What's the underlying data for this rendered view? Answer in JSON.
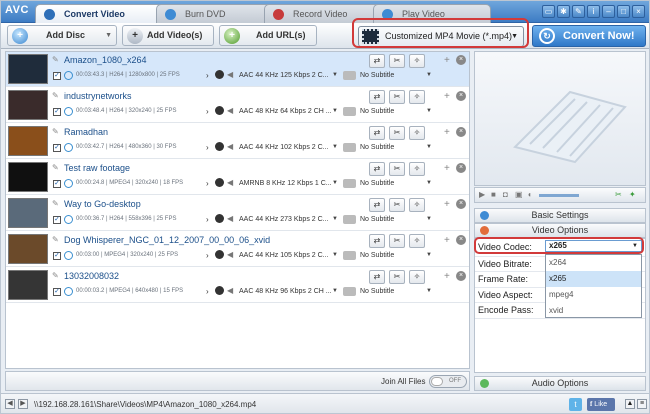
{
  "app": {
    "logo": "AVC"
  },
  "tabs": [
    {
      "label": "Convert Video",
      "active": true,
      "icon": "film-icon"
    },
    {
      "label": "Burn DVD",
      "active": false,
      "icon": "disc-icon"
    },
    {
      "label": "Record Video",
      "active": false,
      "icon": "record-icon"
    },
    {
      "label": "Play Video",
      "active": false,
      "icon": "play-icon"
    }
  ],
  "window_buttons": [
    "monitor-icon",
    "gear-icon",
    "wrench-icon",
    "info-icon",
    "minimize-icon",
    "maximize-icon",
    "close-icon"
  ],
  "toolbar": {
    "add_disc": "Add Disc",
    "add_videos": "Add Video(s)",
    "add_urls": "Add URL(s)",
    "profile": "Customized MP4 Movie (*.mp4)",
    "convert_now": "Convert Now!"
  },
  "files": [
    {
      "name": "Amazon_1080_x264",
      "duration": "00:03:43.3",
      "codec": "H264",
      "resolution": "1280x800",
      "fps": "25 FPS",
      "audio": "AAC 44 KHz 125 Kbps 2 C...",
      "subtitle": "No Subtitle",
      "selected": true
    },
    {
      "name": "industrynetworks",
      "duration": "00:03:48.4",
      "codec": "H264",
      "resolution": "320x240",
      "fps": "25 FPS",
      "audio": "AAC 48 KHz 64 Kbps 2 CH ...",
      "subtitle": "No Subtitle",
      "selected": false
    },
    {
      "name": "Ramadhan",
      "duration": "00:03:42.7",
      "codec": "H264",
      "resolution": "480x360",
      "fps": "30 FPS",
      "audio": "AAC 44 KHz 102 Kbps 2 C...",
      "subtitle": "No Subtitle",
      "selected": false
    },
    {
      "name": "Test raw footage",
      "duration": "00:00:24.8",
      "codec": "MPEG4",
      "resolution": "320x240",
      "fps": "18 FPS",
      "audio": "AMRNB 8 KHz 12 Kbps 1 C...",
      "subtitle": "No Subtitle",
      "selected": false
    },
    {
      "name": "Way to Go-desktop",
      "duration": "00:00:36.7",
      "codec": "H264",
      "resolution": "558x396",
      "fps": "25 FPS",
      "audio": "AAC 44 KHz 273 Kbps 2 C...",
      "subtitle": "No Subtitle",
      "selected": false
    },
    {
      "name": "Dog Whisperer_NGC_01_12_2007_00_00_06_xvid",
      "duration": "00:03:00",
      "codec": "MPEG4",
      "resolution": "320x240",
      "fps": "25 FPS",
      "audio": "AAC 44 KHz 105 Kbps 2 C...",
      "subtitle": "No Subtitle",
      "selected": false
    },
    {
      "name": "13032008032",
      "duration": "00:00:03.2",
      "codec": "MPEG4",
      "resolution": "640x480",
      "fps": "15 FPS",
      "audio": "AAC 48 KHz 96 Kbps 2 CH ...",
      "subtitle": "No Subtitle",
      "selected": false
    }
  ],
  "settings": {
    "basic_settings": "Basic Settings",
    "video_options": "Video Options",
    "audio_options": "Audio Options",
    "labels": [
      "Video Codec:",
      "Video Bitrate:",
      "Frame Rate:",
      "Video Aspect:",
      "Encode Pass:"
    ],
    "codec_value": "x265",
    "codec_options": [
      "x264",
      "x265",
      "mpeg4",
      "xvid"
    ],
    "codec_selected_option": "x265"
  },
  "join": {
    "label": "Join All Files",
    "toggle": "OFF"
  },
  "status": {
    "path": "\\\\192.168.28.161\\Share\\Videos\\MP4\\Amazon_1080_x264.mp4",
    "like": "Like"
  },
  "colors": {
    "accent": "#3d7cc4",
    "highlight": "#d23a3a",
    "selected_row": "#d6e7fa"
  }
}
